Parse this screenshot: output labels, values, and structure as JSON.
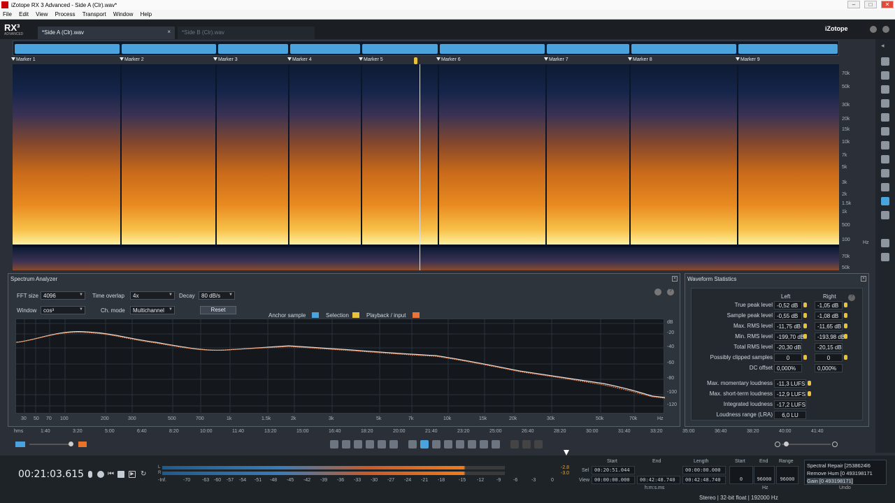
{
  "window": {
    "title": "iZotope RX 3 Advanced - Side A (Clr).wav*"
  },
  "menu": [
    "File",
    "Edit",
    "View",
    "Process",
    "Transport",
    "Window",
    "Help"
  ],
  "app": {
    "logo": "RX³",
    "logo_sub": "ADVANCED",
    "brand": "iZotope"
  },
  "tabs": [
    {
      "label": "*Side A (Clr).wav",
      "close": "×"
    },
    {
      "label": "*Side B (Clr).wav"
    }
  ],
  "markers": [
    "Marker 1",
    "Marker 2",
    "Marker 3",
    "Marker 4",
    "Marker 5",
    "Marker 6",
    "Marker 7",
    "Marker 8",
    "Marker 9"
  ],
  "freq_scale": [
    "70k",
    "50k",
    "30k",
    "20k",
    "15k",
    "10k",
    "7k",
    "5k",
    "3k",
    "2k",
    "1.5k",
    "1k",
    "500",
    "100",
    "Hz",
    "70k",
    "50k"
  ],
  "spectrum": {
    "title": "Spectrum Analyzer",
    "fft_label": "FFT size",
    "fft_value": "4096",
    "overlap_label": "Time overlap",
    "overlap_value": "4x",
    "decay_label": "Decay",
    "decay_value": "80 dB/s",
    "window_label": "Window",
    "window_value": "cos³",
    "chmode_label": "Ch. mode",
    "chmode_value": "Multichannel",
    "reset": "Reset",
    "anchor": "Anchor sample",
    "selection": "Selection",
    "playback": "Playback / input",
    "y_ticks": [
      "dB",
      "-20",
      "-40",
      "-60",
      "-80",
      "-100",
      "-120"
    ],
    "x_ticks": [
      "30",
      "50",
      "70",
      "100",
      "200",
      "300",
      "500",
      "700",
      "1k",
      "1.5k",
      "2k",
      "3k",
      "5k",
      "7k",
      "10k",
      "15k",
      "20k",
      "30k",
      "50k",
      "70k",
      "Hz"
    ]
  },
  "stats": {
    "title": "Waveform Statistics",
    "col_left": "Left",
    "col_right": "Right",
    "rows": [
      {
        "label": "True peak level",
        "left": "-0,52 dB",
        "right": "-1,05 dB"
      },
      {
        "label": "Sample peak level",
        "left": "-0,55 dB",
        "right": "-1,08 dB"
      },
      {
        "label": "Max. RMS level",
        "left": "-11,75 dB",
        "right": "-11,65 dB"
      },
      {
        "label": "Min. RMS level",
        "left": "-199,70 dB",
        "right": "-193,98 dB"
      },
      {
        "label": "Total RMS level",
        "left": "-20,30 dB",
        "right": "-20,15 dB"
      },
      {
        "label": "Possibly clipped samples",
        "left": "0",
        "right": "0"
      },
      {
        "label": "DC offset",
        "left": "0,000%",
        "right": "0,000%"
      }
    ],
    "loud": [
      {
        "label": "Max. momentary loudness",
        "value": "-11,3 LUFS"
      },
      {
        "label": "Max. short-term loudness",
        "value": "-12,9 LUFS"
      },
      {
        "label": "Integrated loudness",
        "value": "-17,2 LUFS"
      },
      {
        "label": "Loudness range (LRA)",
        "value": "6,0 LU"
      }
    ]
  },
  "timeline": [
    "hms",
    "1:40",
    "3:20",
    "5:00",
    "6:40",
    "8:20",
    "10:00",
    "11:40",
    "13:20",
    "15:00",
    "16:40",
    "18:20",
    "20:00",
    "21:40",
    "23:20",
    "25:00",
    "26:40",
    "28:20",
    "30:00",
    "31:40",
    "33:20",
    "35:00",
    "36:40",
    "38:20",
    "40:00",
    "41:40"
  ],
  "transport": {
    "timecode": "00:21:03.615"
  },
  "meter": {
    "l": "L",
    "r": "R",
    "peak_l": "-2.8",
    "peak_r": "-3.0",
    "scale": [
      "-Inf.",
      "-70",
      "-63",
      "-60",
      "-57",
      "-54",
      "-51",
      "-48",
      "-45",
      "-42",
      "-39",
      "-36",
      "-33",
      "-30",
      "-27",
      "-24",
      "-21",
      "-18",
      "-15",
      "-12",
      "-9",
      "-6",
      "-3",
      "0"
    ]
  },
  "selection": {
    "headers": [
      "Start",
      "End",
      "Length",
      "Start",
      "End",
      "Range"
    ],
    "sel_label": "Sel",
    "view_label": "View",
    "sel": [
      "00:20:51.044",
      "00:00:00.000",
      "00:00:00.000"
    ],
    "view": [
      "00:00:00.000",
      "00:42:48.740",
      "00:42:48.740",
      "0",
      "96000",
      "96000"
    ],
    "unit_time": "h:m:s.ms",
    "unit_hz": "Hz"
  },
  "history": {
    "items": [
      "Spectral Repair [2538624l6",
      "Remove Hum [0 493198171",
      "Gain [0 493198171]"
    ],
    "undo": "Undo"
  },
  "status": [
    "Stereo",
    "32-bit float",
    "192000 Hz"
  ]
}
